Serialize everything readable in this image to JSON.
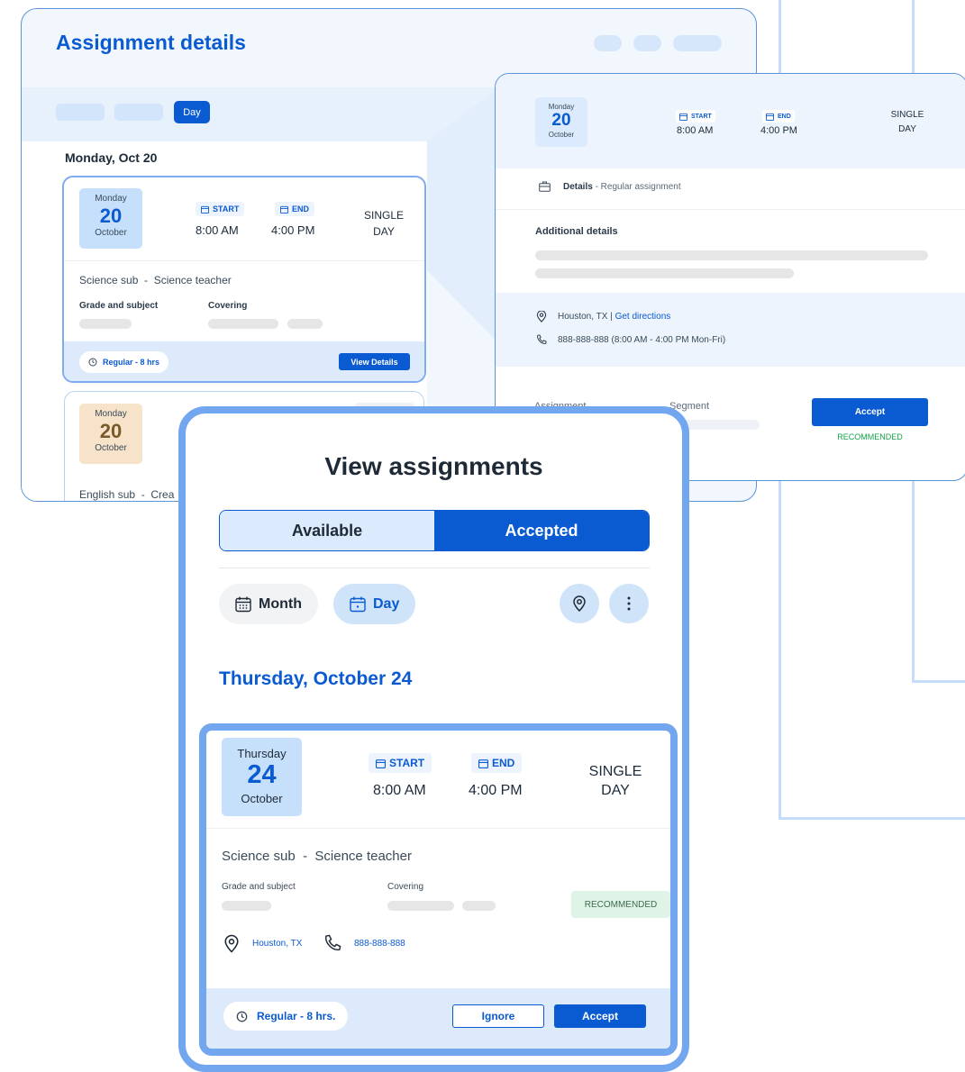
{
  "colors": {
    "primary": "#0a5ad1",
    "frame": "#72a6ef",
    "panel": "#edf4fd",
    "recommended": "#16a34a",
    "tan": "#f6e3c9"
  },
  "details_window": {
    "title": "Assignment details",
    "day_tab": "Day",
    "date_heading": "Monday, Oct 20",
    "card1": {
      "dow": "Monday",
      "day": "20",
      "month": "October",
      "start_label": "START",
      "start_time": "8:00 AM",
      "end_label": "END",
      "end_time": "4:00 PM",
      "single_line1": "SINGLE",
      "single_line2": "DAY",
      "role": "Science sub",
      "role_sep": "-",
      "role_desc": "Science teacher",
      "grade_label": "Grade and subject",
      "covering_label": "Covering",
      "regular_label": "Regular - 8 hrs",
      "view_details": "View Details"
    },
    "card2": {
      "dow": "Monday",
      "day": "20",
      "month": "October",
      "role": "English sub",
      "role_sep": "-",
      "role_desc": "Crea"
    }
  },
  "detail_panel": {
    "dow": "Monday",
    "day": "20",
    "month": "October",
    "start_label": "START",
    "start_time": "8:00 AM",
    "end_label": "END",
    "end_time": "4:00 PM",
    "single_line1": "SINGLE",
    "single_line2": "DAY",
    "details_label": "Details",
    "details_text": "- Regular assignment",
    "additional_details": "Additional details",
    "location": "Houston, TX |",
    "get_directions": "Get directions",
    "phone": "888-888-888 (8:00 AM - 4:00 PM Mon-Fri)",
    "assignment_label": "Assignment",
    "segment_label": "Segment",
    "accept": "Accept",
    "recommended": "RECOMMENDED"
  },
  "phone": {
    "title": "View assignments",
    "tab_available": "Available",
    "tab_accepted": "Accepted",
    "month_chip": "Month",
    "day_chip": "Day",
    "date_heading": "Thursday, October 24",
    "card": {
      "dow": "Thursday",
      "day": "24",
      "month": "October",
      "start_label": "START",
      "start_time": "8:00 AM",
      "end_label": "END",
      "end_time": "4:00 PM",
      "single_line1": "SINGLE",
      "single_line2": "DAY",
      "role": "Science sub",
      "role_sep": "-",
      "role_desc": "Science teacher",
      "grade_label": "Grade and subject",
      "covering_label": "Covering",
      "recommended": "RECOMMENDED",
      "location": "Houston, TX",
      "phone": "888-888-888",
      "regular_label": "Regular - 8 hrs.",
      "ignore": "Ignore",
      "accept": "Accept"
    }
  }
}
